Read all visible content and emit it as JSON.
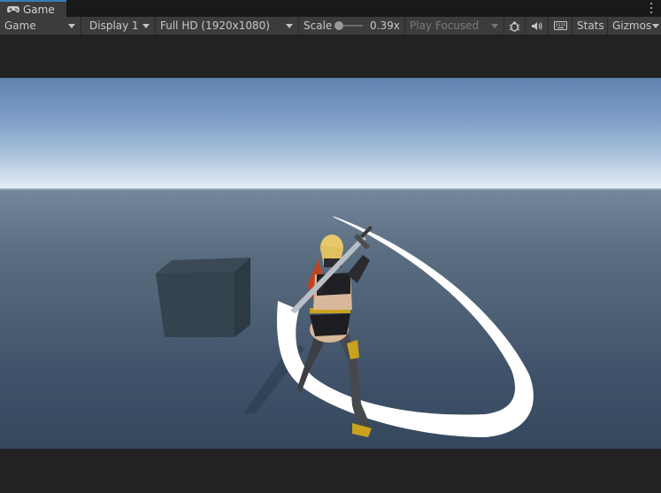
{
  "window": {
    "tab_label": "Game",
    "tab_icon": "gamepad-icon"
  },
  "toolbar": {
    "view_mode": "Game",
    "display": "Display 1",
    "resolution": "Full HD (1920x1080)",
    "scale_label": "Scale",
    "scale_value": "0.39x",
    "play_mode": "Play Focused",
    "stats_label": "Stats",
    "gizmos_label": "Gizmos",
    "icons": [
      "bug-icon",
      "speaker-icon",
      "keyboard-icon"
    ]
  },
  "colors": {
    "tab_accent": "#3a79bb",
    "toolbar_bg": "#3c3c3c",
    "panel_bg": "#191919"
  }
}
